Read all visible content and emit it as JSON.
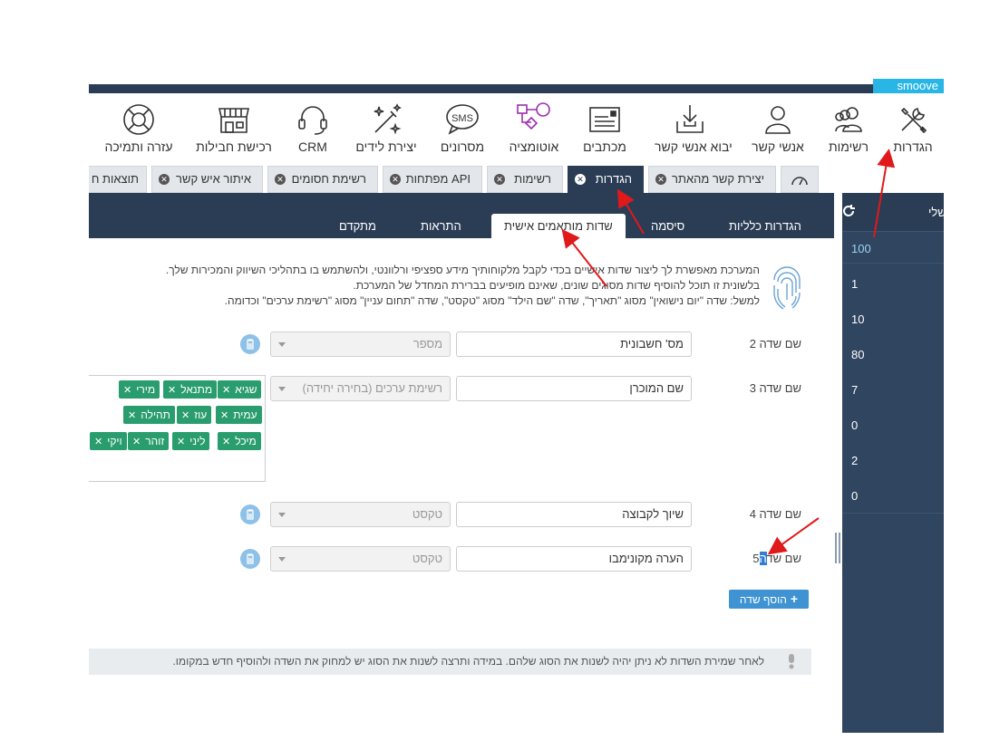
{
  "brand": "smoove",
  "toolbar": [
    {
      "label": "הגדרות",
      "icon": "tools-icon"
    },
    {
      "label": "רשימות",
      "icon": "users-group-icon"
    },
    {
      "label": "אנשי קשר",
      "icon": "user-icon"
    },
    {
      "label": "יבוא אנשי קשר",
      "icon": "import-icon"
    },
    {
      "label": "מכתבים",
      "icon": "newsletter-icon"
    },
    {
      "label": "אוטומציה",
      "icon": "automation-icon"
    },
    {
      "label": "מסרונים",
      "icon": "sms-icon"
    },
    {
      "label": "יצירת לידים",
      "icon": "magic-wand-icon"
    },
    {
      "label": "CRM",
      "icon": "headset-icon"
    },
    {
      "label": "רכישת חבילות",
      "icon": "store-icon"
    },
    {
      "label": "עזרה ותמיכה",
      "icon": "lifebuoy-icon"
    }
  ],
  "tabs": [
    {
      "label": "יצירת קשר מהאתר"
    },
    {
      "label": "הגדרות",
      "active": true
    },
    {
      "label": "רשימות"
    },
    {
      "label": "מפתחות API"
    },
    {
      "label": "רשימת חסומים"
    },
    {
      "label": "איתור איש קשר"
    },
    {
      "label": "תוצאות ח"
    }
  ],
  "subtabs": {
    "general": "הגדרות כלליות",
    "password": "סיסמה",
    "custom_fields": "שדות מותאמים אישית",
    "alerts": "התראות",
    "advanced": "מתקדם"
  },
  "right_panel": {
    "header": "שלי",
    "values": [
      "100",
      "1",
      "10",
      "80",
      "7",
      "0",
      "2",
      "0"
    ]
  },
  "description": [
    "המערכת מאפשרת לך ליצור שדות אישיים בכדי לקבל מלקוחותיך מידע ספציפי ורלוונטי, ולהשתמש בו בתהליכי השיווק והמכירות שלך.",
    "בלשונית זו תוכל להוסיף שדות מסוגים שונים, שאינם מופיעים בברירת המחדל של המערכת.",
    "למשל: שדה \"יום נישואין\" מסוג \"תאריך\", שדה \"שם הילד\" מסוג \"טקסט\", שדה \"תחום עניין\" מסוג \"רשימת ערכים\" וכדומה."
  ],
  "fields": [
    {
      "label": "שם שדה 2",
      "value": "מס' חשבונית",
      "type": "מספר"
    },
    {
      "label": "שם שדה 3",
      "value": "שם המוכרן",
      "type": "רשימת ערכים (בחירה יחידה)"
    },
    {
      "label": "שם שדה 4",
      "value": "שיוך לקבוצה",
      "type": "טקסט"
    },
    {
      "label": "שם שדה 5",
      "value": "הערה מקונימבו",
      "type": "טקסט"
    }
  ],
  "field5_label_parts": {
    "a": "שם שד",
    "b": "ה",
    "c": "5"
  },
  "tags": [
    "שגיא",
    "מתנאל",
    "מירי",
    "עמית",
    "עוז",
    "תהילה",
    "מיכל",
    "ליני",
    "זוהר",
    "ויקי"
  ],
  "add_field_button": "הוסף שדה",
  "notice": "לאחר שמירת השדות לא ניתן יהיה לשנות את הסוג שלהם. במידה ותרצה לשנות את הסוג יש למחוק את השדה ולהוסיף חדש במקומו.",
  "colors": {
    "navy": "#2a3d55",
    "accent": "#29b6e6",
    "tag_green": "#2a9d6f",
    "button_blue": "#3f93d2",
    "arrow_red": "#e0191b"
  }
}
